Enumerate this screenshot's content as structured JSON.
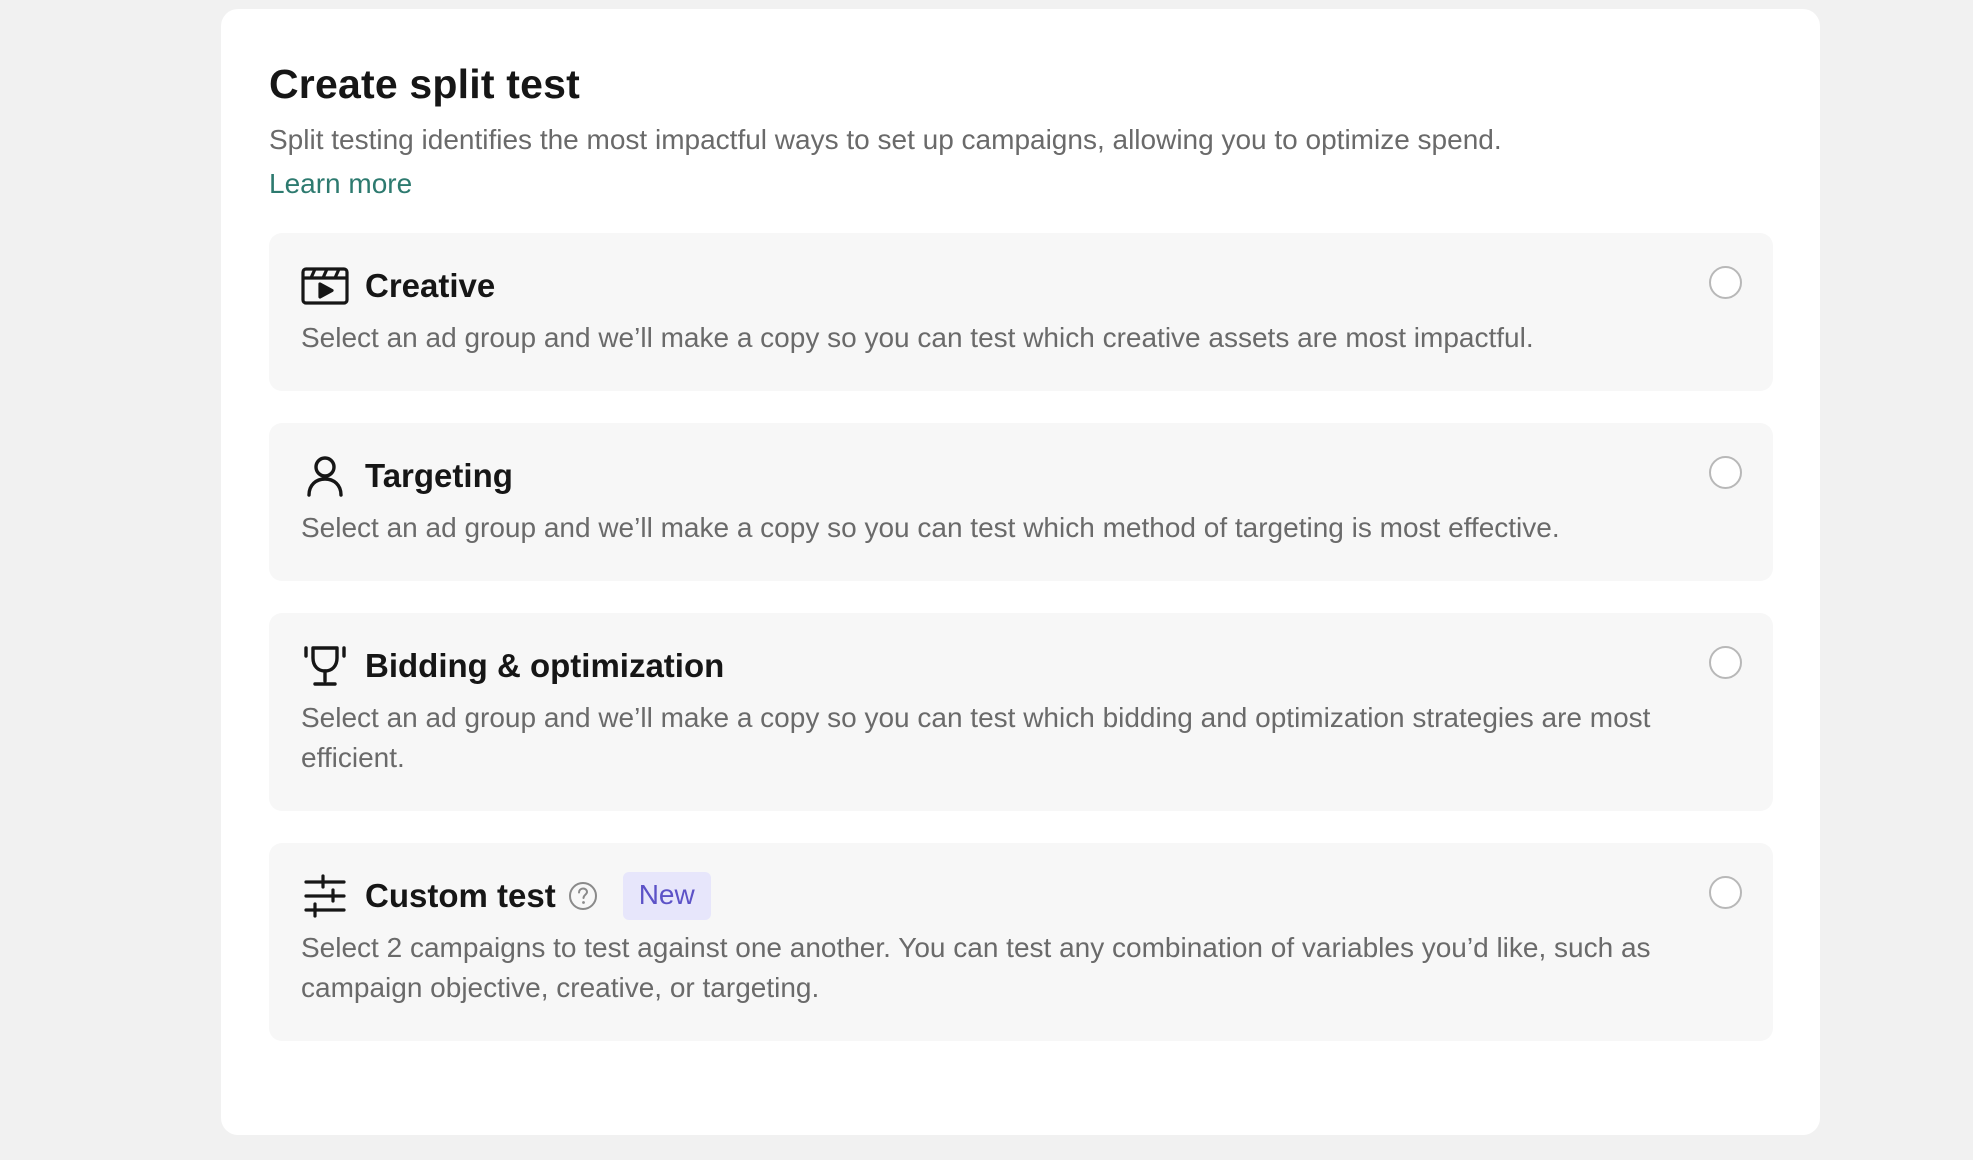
{
  "dialog": {
    "title": "Create split test",
    "subtitle": "Split testing identifies the most impactful ways to set up campaigns, allowing you to optimize spend.",
    "learn_more": "Learn more"
  },
  "options": [
    {
      "icon": "clapperboard-icon",
      "title": "Creative",
      "description": "Select an ad group and we’ll make a copy so you can test which creative assets are most impactful.",
      "selected": false
    },
    {
      "icon": "person-icon",
      "title": "Targeting",
      "description": "Select an ad group and we’ll make a copy so you can test which method of targeting is most effective.",
      "selected": false
    },
    {
      "icon": "trophy-icon",
      "title": "Bidding & optimization",
      "description": "Select an ad group and we’ll make a copy so you can test which bidding and optimization strategies are most efficient.",
      "selected": false
    },
    {
      "icon": "sliders-icon",
      "title": "Custom test",
      "help_icon": "question-circle-icon",
      "badge": "New",
      "description": "Select 2 campaigns to test against one another. You can test any combination of variables you’d like, such as campaign objective, creative, or targeting.",
      "selected": false
    }
  ],
  "colors": {
    "link": "#2d7a6f",
    "badge_bg": "#e7e6fb",
    "badge_text": "#5c52c7",
    "option_bg": "#f7f7f7",
    "page_bg": "#f1f1f1"
  }
}
